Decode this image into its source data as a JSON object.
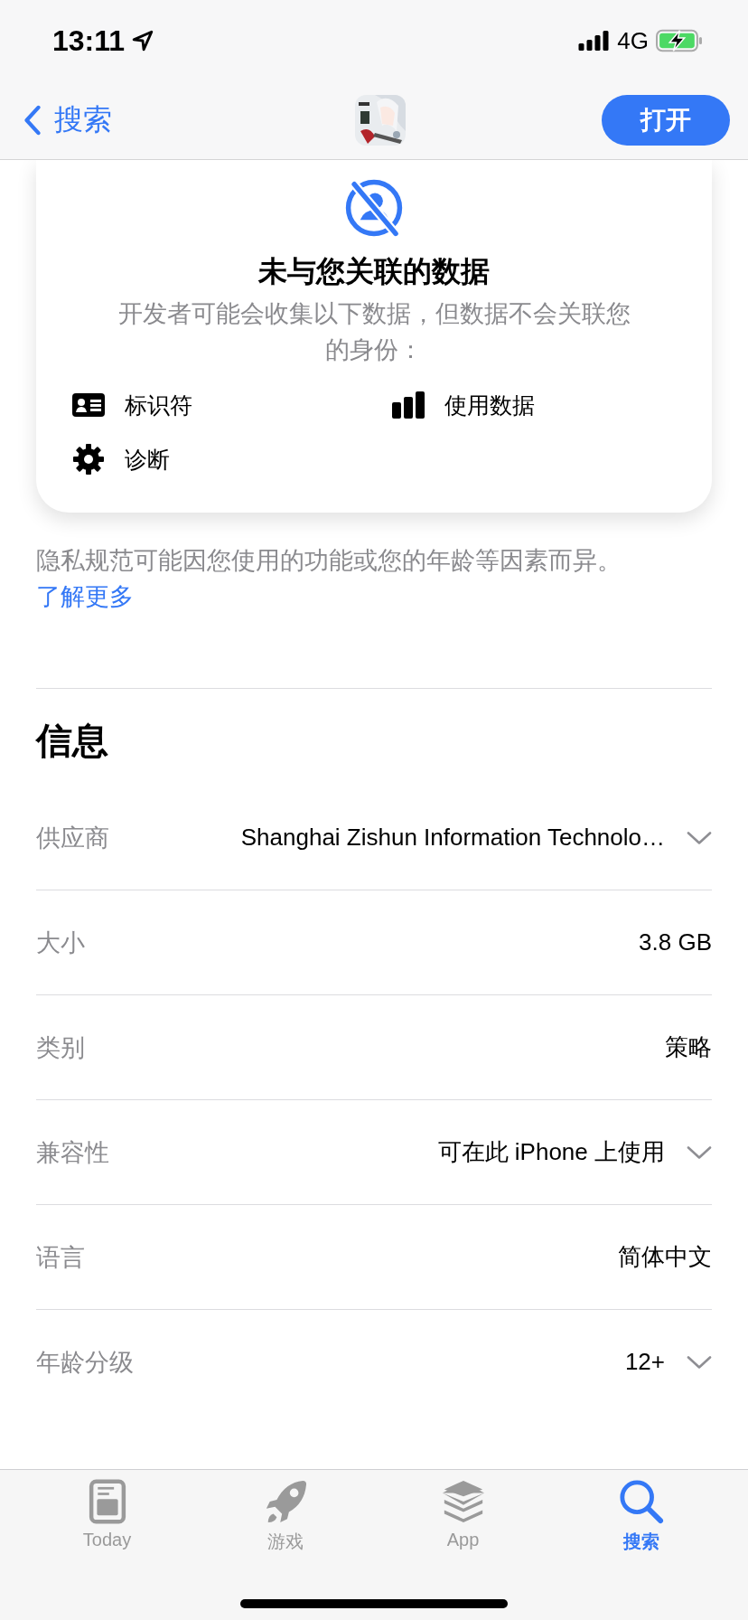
{
  "status_bar": {
    "time": "13:11",
    "network": "4G"
  },
  "nav": {
    "back_label": "搜索",
    "open_button": "打开"
  },
  "privacy_card": {
    "title": "未与您关联的数据",
    "description": "开发者可能会收集以下数据，但数据不会关联您的身份：",
    "items": [
      {
        "kind": "id",
        "label": "标识符"
      },
      {
        "kind": "usage",
        "label": "使用数据"
      },
      {
        "kind": "diagnostics",
        "label": "诊断"
      }
    ]
  },
  "note": "隐私规范可能因您使用的功能或您的年龄等因素而异。",
  "learn_more": "了解更多",
  "info": {
    "heading": "信息",
    "rows": [
      {
        "label": "供应商",
        "value": "Shanghai Zishun Information Technolo…",
        "expandable": true
      },
      {
        "label": "大小",
        "value": "3.8 GB",
        "expandable": false
      },
      {
        "label": "类别",
        "value": "策略",
        "expandable": false
      },
      {
        "label": "兼容性",
        "value": "可在此 iPhone 上使用",
        "expandable": true
      },
      {
        "label": "语言",
        "value": "简体中文",
        "expandable": false
      },
      {
        "label": "年龄分级",
        "value": "12+",
        "expandable": true
      }
    ]
  },
  "tab_bar": [
    {
      "kind": "today",
      "label": "Today",
      "selected": false
    },
    {
      "kind": "games",
      "label": "游戏",
      "selected": false
    },
    {
      "kind": "apps",
      "label": "App",
      "selected": false
    },
    {
      "kind": "search",
      "label": "搜索",
      "selected": true
    }
  ]
}
